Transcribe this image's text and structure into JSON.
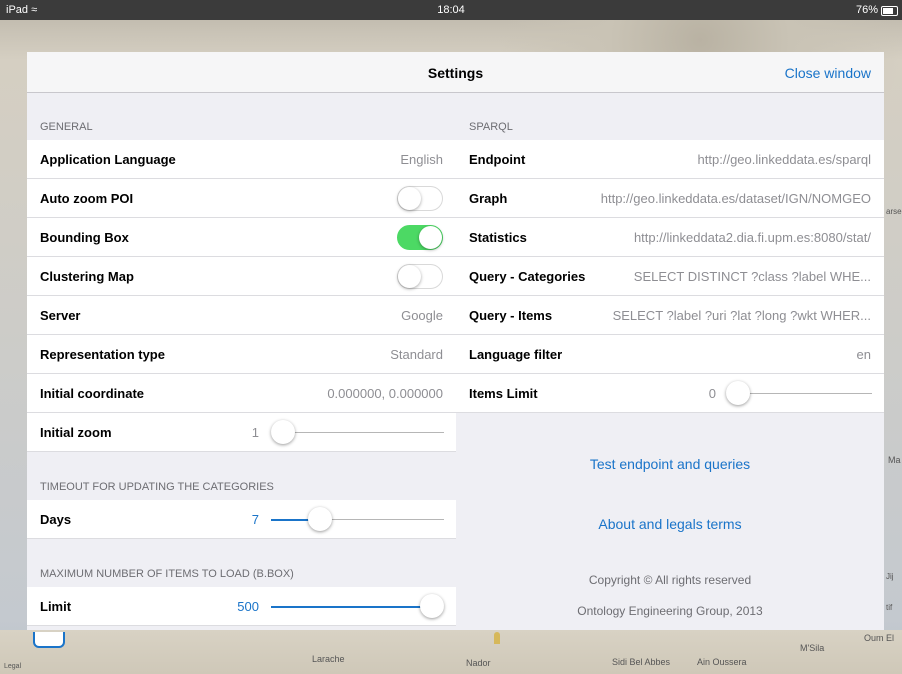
{
  "status_bar": {
    "device": "iPad",
    "wifi_icon": "wifi-icon",
    "time": "18:04",
    "battery": "76%"
  },
  "map": {
    "labels": [
      "Larache",
      "Nador",
      "Sidi Bel Abbes",
      "Ain Oussera",
      "M'Sila",
      "Oum El",
      "Legal",
      "arse",
      "Ma",
      "Jij",
      "tif"
    ]
  },
  "navbar": {
    "title": "Settings",
    "close_label": "Close window"
  },
  "general": {
    "header": "GENERAL",
    "app_language": {
      "label": "Application Language",
      "value": "English"
    },
    "auto_zoom": {
      "label": "Auto zoom POI",
      "on": false
    },
    "bounding_box": {
      "label": "Bounding Box",
      "on": true
    },
    "clustering": {
      "label": "Clustering Map",
      "on": false
    },
    "server": {
      "label": "Server",
      "value": "Google"
    },
    "representation": {
      "label": "Representation type",
      "value": "Standard"
    },
    "initial_coord": {
      "label": "Initial coordinate",
      "value": "0.000000, 0.000000"
    },
    "initial_zoom": {
      "label": "Initial zoom",
      "value": "1",
      "level": 0
    }
  },
  "timeout": {
    "header": "TIMEOUT FOR UPDATING THE CATEGORIES",
    "days": {
      "label": "Days",
      "value": "7",
      "level": 0.25
    }
  },
  "max_items": {
    "header": "MAXIMUM NUMBER OF ITEMS TO LOAD (B.BOX)",
    "limit": {
      "label": "Limit",
      "value": "500",
      "level": 1.0
    }
  },
  "sparql": {
    "header": "SPARQL",
    "endpoint": {
      "label": "Endpoint",
      "value": "http://geo.linkeddata.es/sparql"
    },
    "graph": {
      "label": "Graph",
      "value": "http://geo.linkeddata.es/dataset/IGN/NOMGEO"
    },
    "statistics": {
      "label": "Statistics",
      "value": "http://linkeddata2.dia.fi.upm.es:8080/stat/"
    },
    "query_categories": {
      "label": "Query - Categories",
      "value": "SELECT DISTINCT ?class ?label WHE..."
    },
    "query_items": {
      "label": "Query - Items",
      "value": "SELECT ?label ?uri ?lat ?long ?wkt WHER..."
    },
    "language_filter": {
      "label": "Language filter",
      "value": "en"
    },
    "items_limit": {
      "label": "Items Limit",
      "value": "0",
      "level": 0
    }
  },
  "actions": {
    "test": "Test endpoint and queries",
    "about": "About and legals terms"
  },
  "footer": {
    "copyright": "Copyright © All rights reserved",
    "org": "Ontology Engineering Group, 2013"
  },
  "colors": {
    "accent": "#1a74c9",
    "toggle_on": "#4cd964"
  }
}
